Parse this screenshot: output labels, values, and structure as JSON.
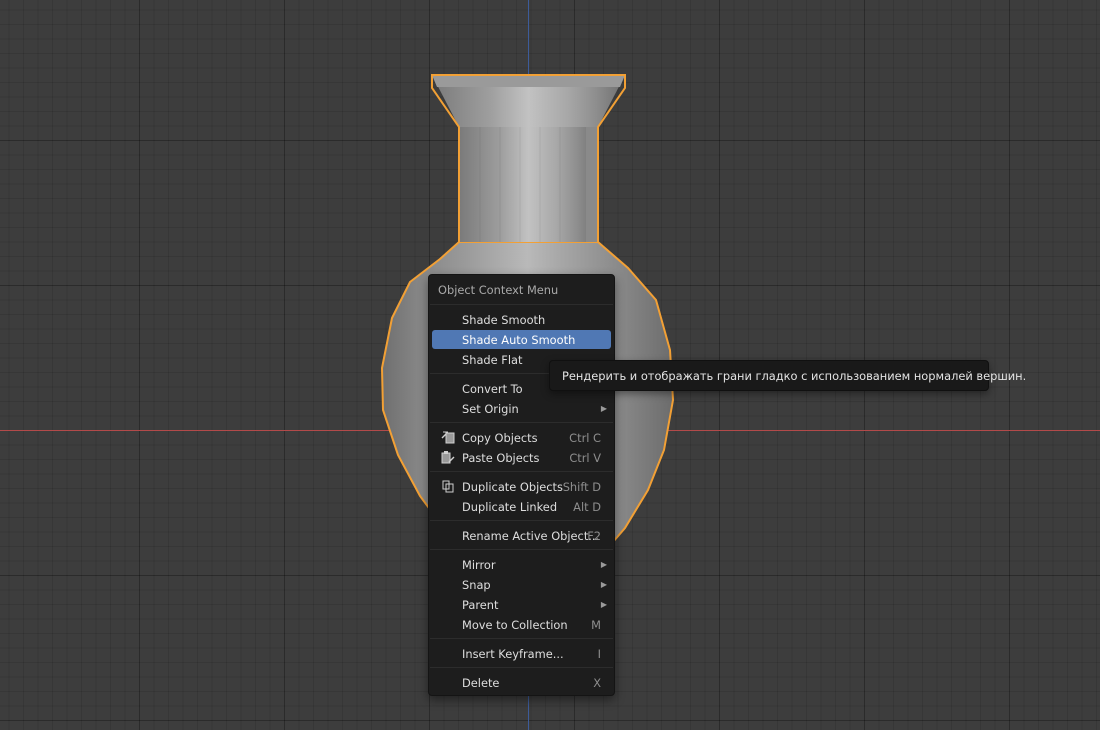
{
  "colors": {
    "viewport_bg": "#3d3d3d",
    "selection_outline": "#f2a035",
    "highlight": "#5078b4",
    "menu_bg": "#1d1d1d",
    "x_axis": "#b34a4a",
    "y_axis": "#3d5c9a"
  },
  "menu": {
    "title": "Object Context Menu",
    "items": [
      {
        "label": "Shade Smooth",
        "shortcut": "",
        "submenu": false,
        "icon": ""
      },
      {
        "label": "Shade Auto Smooth",
        "shortcut": "",
        "submenu": false,
        "icon": "",
        "highlighted": true
      },
      {
        "label": "Shade Flat",
        "shortcut": "",
        "submenu": false,
        "icon": ""
      },
      {
        "label": "Convert To",
        "shortcut": "",
        "submenu": true,
        "icon": ""
      },
      {
        "label": "Set Origin",
        "shortcut": "",
        "submenu": true,
        "icon": ""
      },
      {
        "label": "Copy Objects",
        "shortcut": "Ctrl C",
        "submenu": false,
        "icon": "copy-icon"
      },
      {
        "label": "Paste Objects",
        "shortcut": "Ctrl V",
        "submenu": false,
        "icon": "paste-icon"
      },
      {
        "label": "Duplicate Objects",
        "shortcut": "Shift D",
        "submenu": false,
        "icon": "duplicate-icon"
      },
      {
        "label": "Duplicate Linked",
        "shortcut": "Alt D",
        "submenu": false,
        "icon": ""
      },
      {
        "label": "Rename Active Object...",
        "shortcut": "F2",
        "submenu": false,
        "icon": ""
      },
      {
        "label": "Mirror",
        "shortcut": "",
        "submenu": true,
        "icon": ""
      },
      {
        "label": "Snap",
        "shortcut": "",
        "submenu": true,
        "icon": ""
      },
      {
        "label": "Parent",
        "shortcut": "",
        "submenu": true,
        "icon": ""
      },
      {
        "label": "Move to Collection",
        "shortcut": "M",
        "submenu": false,
        "icon": ""
      },
      {
        "label": "Insert Keyframe...",
        "shortcut": "I",
        "submenu": false,
        "icon": ""
      },
      {
        "label": "Delete",
        "shortcut": "X",
        "submenu": false,
        "icon": ""
      }
    ]
  },
  "tooltip": {
    "text": "Рендерить и отображать грани гладко с использованием нормалей вершин."
  }
}
